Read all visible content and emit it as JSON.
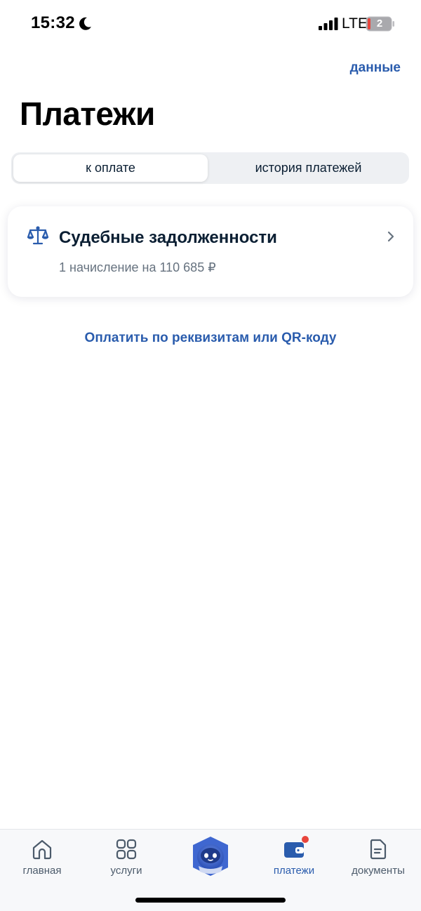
{
  "status_bar": {
    "time": "15:32",
    "network": "LTE",
    "battery": "2"
  },
  "header": {
    "data_link": "данные",
    "title": "Платежи"
  },
  "tabs": [
    {
      "label": "к оплате",
      "active": true
    },
    {
      "label": "история платежей",
      "active": false
    }
  ],
  "card": {
    "title": "Судебные задолженности",
    "subtitle": "1 начисление на 110 685 ₽",
    "icon": "scales-icon"
  },
  "pay_link": "Оплатить по реквизитам или QR-коду",
  "bottom_nav": {
    "items": [
      {
        "label": "главная",
        "icon": "home-icon"
      },
      {
        "label": "услуги",
        "icon": "grid-icon"
      },
      {
        "label": "",
        "icon": "assistant-robot-icon"
      },
      {
        "label": "платежи",
        "icon": "wallet-icon",
        "active": true
      },
      {
        "label": "документы",
        "icon": "document-icon"
      }
    ]
  },
  "colors": {
    "accent": "#2a5cad",
    "text": "#0b1f33",
    "muted": "#66727f",
    "badge": "#e8453c"
  }
}
